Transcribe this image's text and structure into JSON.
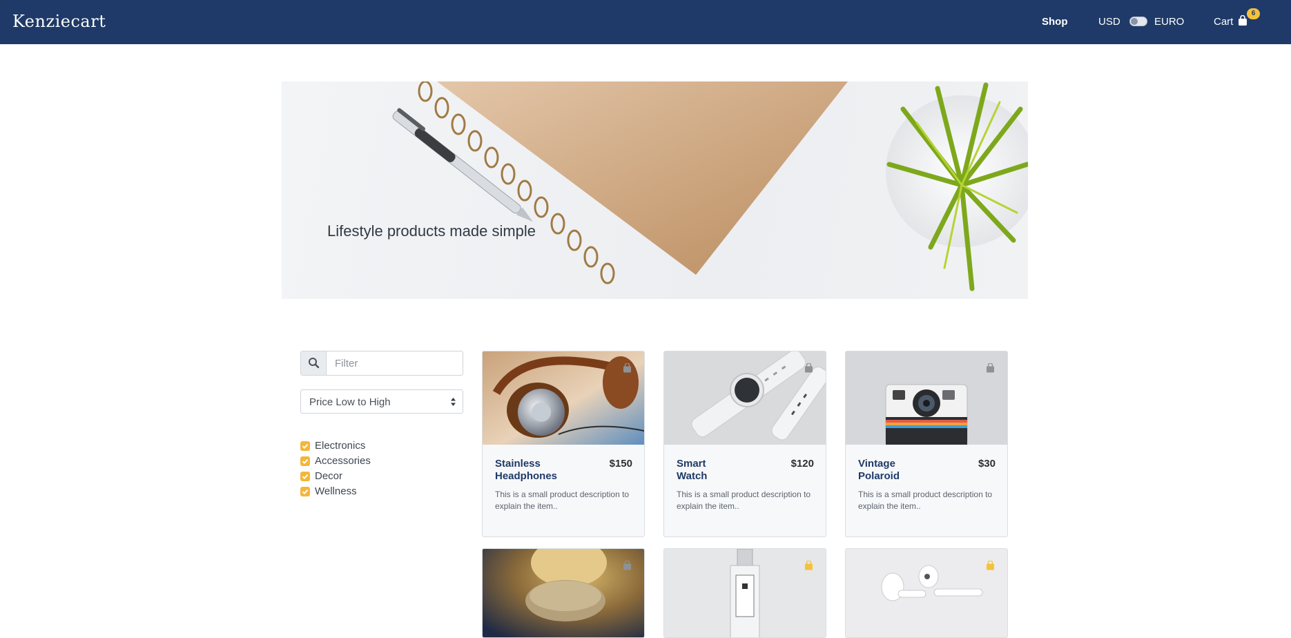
{
  "nav": {
    "brand": "Kenziecart",
    "shop": "Shop",
    "currency_left": "USD",
    "currency_right": "EURO",
    "cart": "Cart",
    "cart_count": "6"
  },
  "hero": {
    "title": "Lifestyle products made simple"
  },
  "filters": {
    "search_placeholder": "Filter",
    "sort_selected": "Price Low to High",
    "categories": [
      "Electronics",
      "Accessories",
      "Decor",
      "Wellness"
    ]
  },
  "products": [
    {
      "name": "Stainless Headphones",
      "price": "$150",
      "description": "This is a small product description to explain the item..",
      "in_cart": false
    },
    {
      "name": "Smart Watch",
      "price": "$120",
      "description": "This is a small product description to explain the item..",
      "in_cart": false
    },
    {
      "name": "Vintage Polaroid",
      "price": "$30",
      "description": "This is a small product description to explain the item..",
      "in_cart": false
    },
    {
      "name": "",
      "price": "",
      "description": "",
      "in_cart": false
    },
    {
      "name": "",
      "price": "",
      "description": "",
      "in_cart": true
    },
    {
      "name": "",
      "price": "",
      "description": "",
      "in_cart": true
    }
  ],
  "colors": {
    "navbar": "#1f3a68",
    "accent": "#f4c23a",
    "bag_inactive": "#8e9196"
  }
}
